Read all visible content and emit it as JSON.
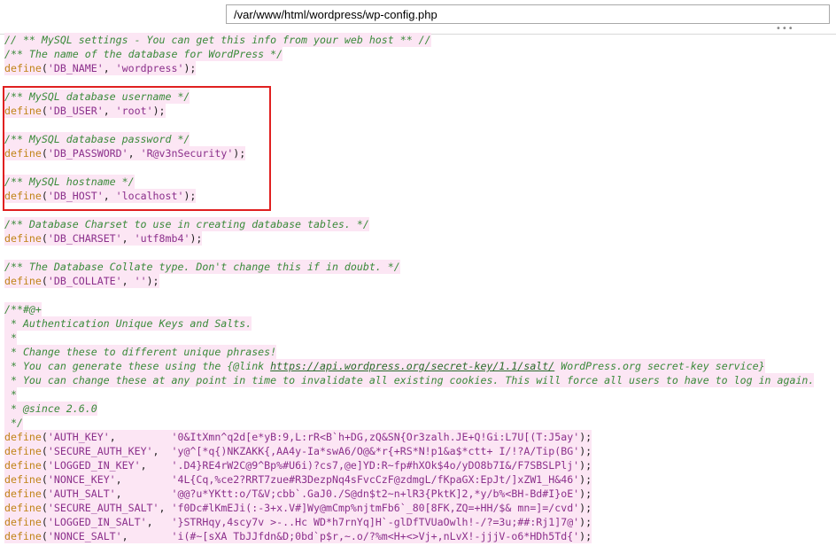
{
  "toolbar": {
    "file_path": "/var/www/html/wordpress/wp-config.php",
    "splitter": "•••"
  },
  "editor": {
    "lines": [
      {
        "text": "// ** MySQL settings - You can get this info from your web host ** //",
        "type": "comment",
        "hl": true
      },
      {
        "text": "/** The name of the database for WordPress */",
        "type": "comment",
        "hl": true
      },
      {
        "text": "define('DB_NAME', 'wordpress');",
        "type": "define",
        "hl": true
      },
      {
        "text": "",
        "type": "blank",
        "hl": false
      },
      {
        "text": "/** MySQL database username */",
        "type": "comment",
        "hl": true
      },
      {
        "text": "define('DB_USER', 'root');",
        "type": "define",
        "hl": true
      },
      {
        "text": "",
        "type": "blank",
        "hl": false
      },
      {
        "text": "/** MySQL database password */",
        "type": "comment",
        "hl": true
      },
      {
        "text": "define('DB_PASSWORD', 'R@v3nSecurity');",
        "type": "define",
        "hl": true
      },
      {
        "text": "",
        "type": "blank",
        "hl": false
      },
      {
        "text": "/** MySQL hostname */",
        "type": "comment",
        "hl": true
      },
      {
        "text": "define('DB_HOST', 'localhost');",
        "type": "define",
        "hl": true
      },
      {
        "text": "",
        "type": "blank",
        "hl": false
      },
      {
        "text": "/** Database Charset to use in creating database tables. */",
        "type": "comment",
        "hl": true
      },
      {
        "text": "define('DB_CHARSET', 'utf8mb4');",
        "type": "define",
        "hl": true
      },
      {
        "text": "",
        "type": "blank",
        "hl": false
      },
      {
        "text": "/** The Database Collate type. Don't change this if in doubt. */",
        "type": "comment",
        "hl": true
      },
      {
        "text": "define('DB_COLLATE', '');",
        "type": "define",
        "hl": true
      },
      {
        "text": "",
        "type": "blank",
        "hl": false
      },
      {
        "text": "/**#@+",
        "type": "comment",
        "hl": true
      },
      {
        "text": " * Authentication Unique Keys and Salts.",
        "type": "comment",
        "hl": true
      },
      {
        "text": " *",
        "type": "comment",
        "hl": true
      },
      {
        "text": " * Change these to different unique phrases!",
        "type": "comment",
        "hl": true
      },
      {
        "text": " * You can generate these using the {@link ",
        "type": "comment-link",
        "hl": true,
        "link": "https://api.wordpress.org/secret-key/1.1/salt/",
        "after": " WordPress.org secret-key service}"
      },
      {
        "text": " * You can change these at any point in time to invalidate all existing cookies. This will force all users to have to log in again.",
        "type": "comment",
        "hl": true
      },
      {
        "text": " *",
        "type": "comment",
        "hl": true
      },
      {
        "text": " * @since 2.6.0",
        "type": "comment",
        "hl": true
      },
      {
        "text": " */",
        "type": "comment",
        "hl": true
      },
      {
        "text": "define('AUTH_KEY',         '0&ItXmn^q2d[e*yB:9,L:rR<B`h+DG,zQ&SN{Or3zalh.JE+Q!Gi:L7U[(T:J5ay');",
        "type": "define",
        "hl": true
      },
      {
        "text": "define('SECURE_AUTH_KEY',  'y@^[*q{)NKZAKK{,AA4y-Ia*swA6/O@&*r{+RS*N!p1&a$*ctt+ I/!?A/Tip(BG');",
        "type": "define",
        "hl": true
      },
      {
        "text": "define('LOGGED_IN_KEY',    '.D4}RE4rW2C@9^Bp%#U6i)?cs7,@e]YD:R~fp#hXOk$4o/yDO8b7I&/F7SBSLPlj');",
        "type": "define",
        "hl": true
      },
      {
        "text": "define('NONCE_KEY',        '4L{Cq,%ce2?RRT7zue#R3DezpNq4sFvcCzF@zdmgL/fKpaGX:EpJt/]xZW1_H&46');",
        "type": "define",
        "hl": true
      },
      {
        "text": "define('AUTH_SALT',        '@@?u*YKtt:o/T&V;cbb`.GaJ0./S@dn$t2~n+lR3{PktK]2,*y/b%<BH-Bd#I}oE');",
        "type": "define",
        "hl": true
      },
      {
        "text": "define('SECURE_AUTH_SALT', 'f0Dc#lKmEJi(:-3+x.V#]Wy@mCmp%njtmFb6`_80[8FK,ZQ=+HH/$& mn=]=/cvd');",
        "type": "define",
        "hl": true
      },
      {
        "text": "define('LOGGED_IN_SALT',   '}STRHqy,4scy7v >-..Hc WD*h7rnYq]H`-glDfTVUaOwlh!-/?=3u;##:Rj1]7@');",
        "type": "define",
        "hl": true
      },
      {
        "text": "define('NONCE_SALT',       'i(#~[sXA TbJJfdn&D;0bd`p$r,~.o/?%m<H+<>Vj+,nLvX!-jjjV-o6*HDh5Td{');",
        "type": "define",
        "hl": true
      }
    ]
  },
  "colors": {
    "highlight_bg": "#fce6f4",
    "comment": "#3a8a3a",
    "keyword": "#c08418",
    "string": "#8b2f8b",
    "annotation_box": "#e02020"
  }
}
